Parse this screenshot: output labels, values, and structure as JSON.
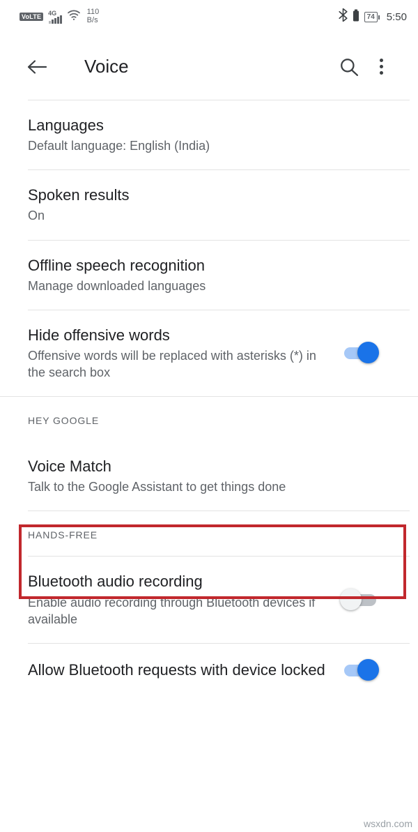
{
  "status_bar": {
    "volte_label": "VoLTE",
    "network_type": "4G",
    "data_rate_value": "110",
    "data_rate_unit": "B/s",
    "battery_percent": "74",
    "time": "5:50",
    "icons": {
      "wifi": "wifi-icon",
      "bluetooth": "bluetooth-icon",
      "signal": "cellular-signal-icon",
      "battery": "battery-icon"
    }
  },
  "app_bar": {
    "back": "back-arrow-icon",
    "title": "Voice",
    "search": "search-icon",
    "overflow": "overflow-menu-icon"
  },
  "sections": [
    {
      "header": null,
      "items": [
        {
          "title": "Languages",
          "subtitle": "Default language: English (India)",
          "control": "none"
        },
        {
          "title": "Spoken results",
          "subtitle": "On",
          "control": "none"
        },
        {
          "title": "Offline speech recognition",
          "subtitle": "Manage downloaded languages",
          "control": "none"
        },
        {
          "title": "Hide offensive words",
          "subtitle": "Offensive words will be replaced with asterisks (*) in the search box",
          "control": "switch",
          "switch_state": "on"
        }
      ]
    },
    {
      "header": "HEY GOOGLE",
      "items": [
        {
          "title": "Voice Match",
          "subtitle": "Talk to the Google Assistant to get things done",
          "control": "none",
          "highlighted": true
        }
      ]
    },
    {
      "header": "HANDS-FREE",
      "items": [
        {
          "title": "Bluetooth audio recording",
          "subtitle": "Enable audio recording through Bluetooth devices if available",
          "control": "switch",
          "switch_state": "off"
        },
        {
          "title": "Allow Bluetooth requests with device locked",
          "subtitle": "",
          "control": "switch",
          "switch_state": "on"
        }
      ]
    }
  ],
  "highlight": {
    "color": "#c1282d"
  },
  "watermark": "wsxdn.com",
  "colors": {
    "accent": "#1a73e8",
    "track_on": "#a6c8f7",
    "track_off": "#bdc1c6",
    "thumb_off": "#f1f3f4",
    "text_primary": "#202124",
    "text_secondary": "#5f6368",
    "divider": "#e3e3e3"
  }
}
